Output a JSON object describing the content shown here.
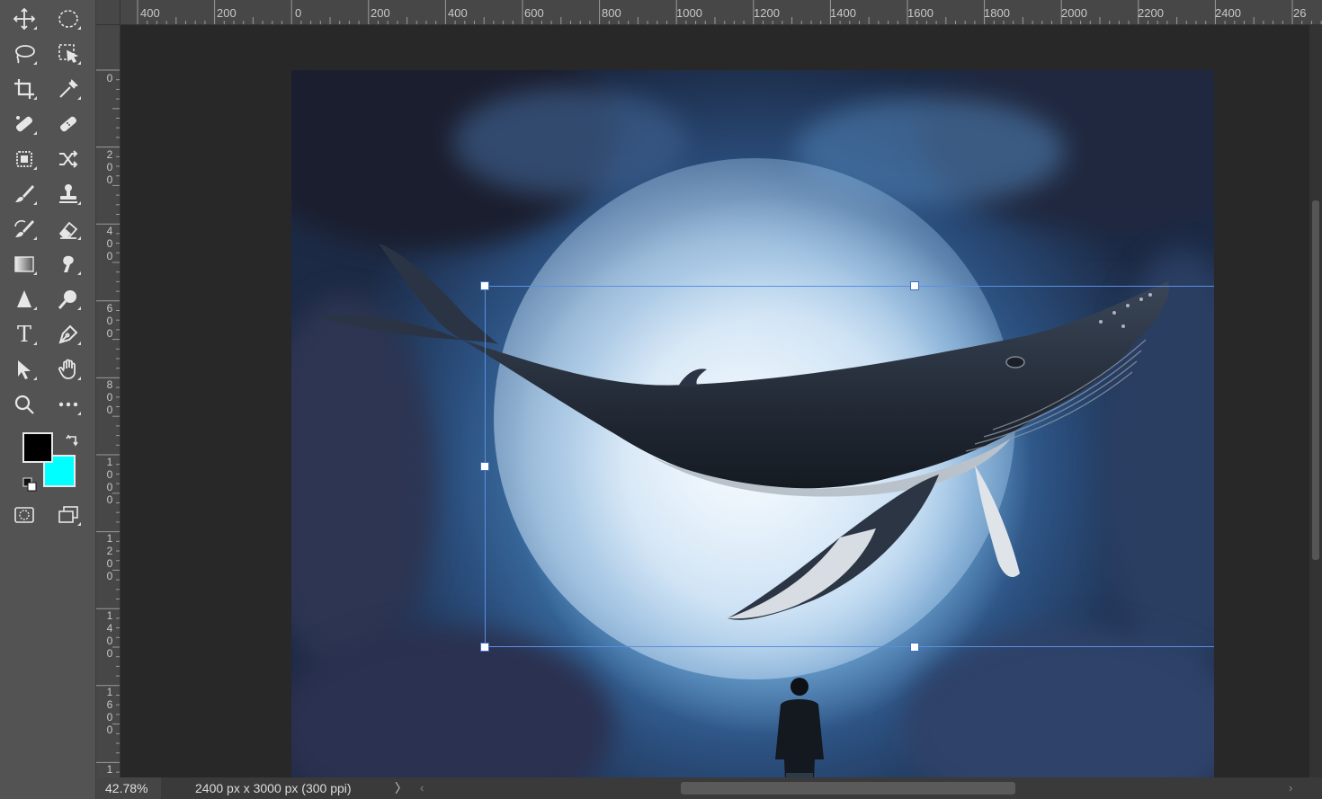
{
  "toolbar": {
    "tools": [
      {
        "name": "move-tool",
        "icon": "move-icon"
      },
      {
        "name": "marquee-tool",
        "icon": "elliptical-marquee-icon"
      },
      {
        "name": "lasso-tool",
        "icon": "lasso-icon"
      },
      {
        "name": "object-selection-tool",
        "icon": "object-selection-icon"
      },
      {
        "name": "crop-tool",
        "icon": "crop-icon"
      },
      {
        "name": "eyedropper-tool",
        "icon": "eyedropper-icon"
      },
      {
        "name": "spot-healing-tool",
        "icon": "spot-healing-icon"
      },
      {
        "name": "healing-brush-tool",
        "icon": "bandage-icon"
      },
      {
        "name": "patch-tool",
        "icon": "patch-icon"
      },
      {
        "name": "content-aware-move-tool",
        "icon": "shuffle-icon"
      },
      {
        "name": "brush-tool",
        "icon": "brush-icon"
      },
      {
        "name": "clone-stamp-tool",
        "icon": "stamp-icon"
      },
      {
        "name": "history-brush-tool",
        "icon": "history-brush-icon"
      },
      {
        "name": "eraser-tool",
        "icon": "eraser-icon"
      },
      {
        "name": "gradient-tool",
        "icon": "gradient-icon"
      },
      {
        "name": "smudge-tool",
        "icon": "smudge-icon"
      },
      {
        "name": "sharpen-tool",
        "icon": "sharpen-icon"
      },
      {
        "name": "dodge-tool",
        "icon": "dodge-icon"
      },
      {
        "name": "type-tool",
        "icon": "type-icon"
      },
      {
        "name": "pen-tool",
        "icon": "pen-icon"
      },
      {
        "name": "path-selection-tool",
        "icon": "arrow-icon"
      },
      {
        "name": "hand-tool",
        "icon": "hand-icon"
      },
      {
        "name": "zoom-tool",
        "icon": "zoom-icon"
      },
      {
        "name": "more-tools",
        "icon": "ellipsis-icon"
      },
      {
        "name": "quick-mask",
        "icon": "quick-mask-icon"
      },
      {
        "name": "screen-mode",
        "icon": "screen-mode-icon"
      }
    ],
    "type_glyph": "T",
    "foreground_color": "#000000",
    "background_color": "#00ffff"
  },
  "ruler_top": {
    "labels": [
      "400",
      "200",
      "0",
      "200",
      "400",
      "600",
      "800",
      "1000",
      "1200",
      "1400",
      "1600",
      "1800",
      "2000",
      "2200",
      "2400",
      "26"
    ]
  },
  "ruler_left": {
    "labels": [
      "0",
      "200",
      "400",
      "600",
      "800",
      "1000",
      "1200",
      "1400",
      "1600",
      "1"
    ]
  },
  "status": {
    "zoom": "42.78%",
    "doc_info": "2400 px x 3000 px (300 ppi)",
    "arrow": "〉"
  }
}
